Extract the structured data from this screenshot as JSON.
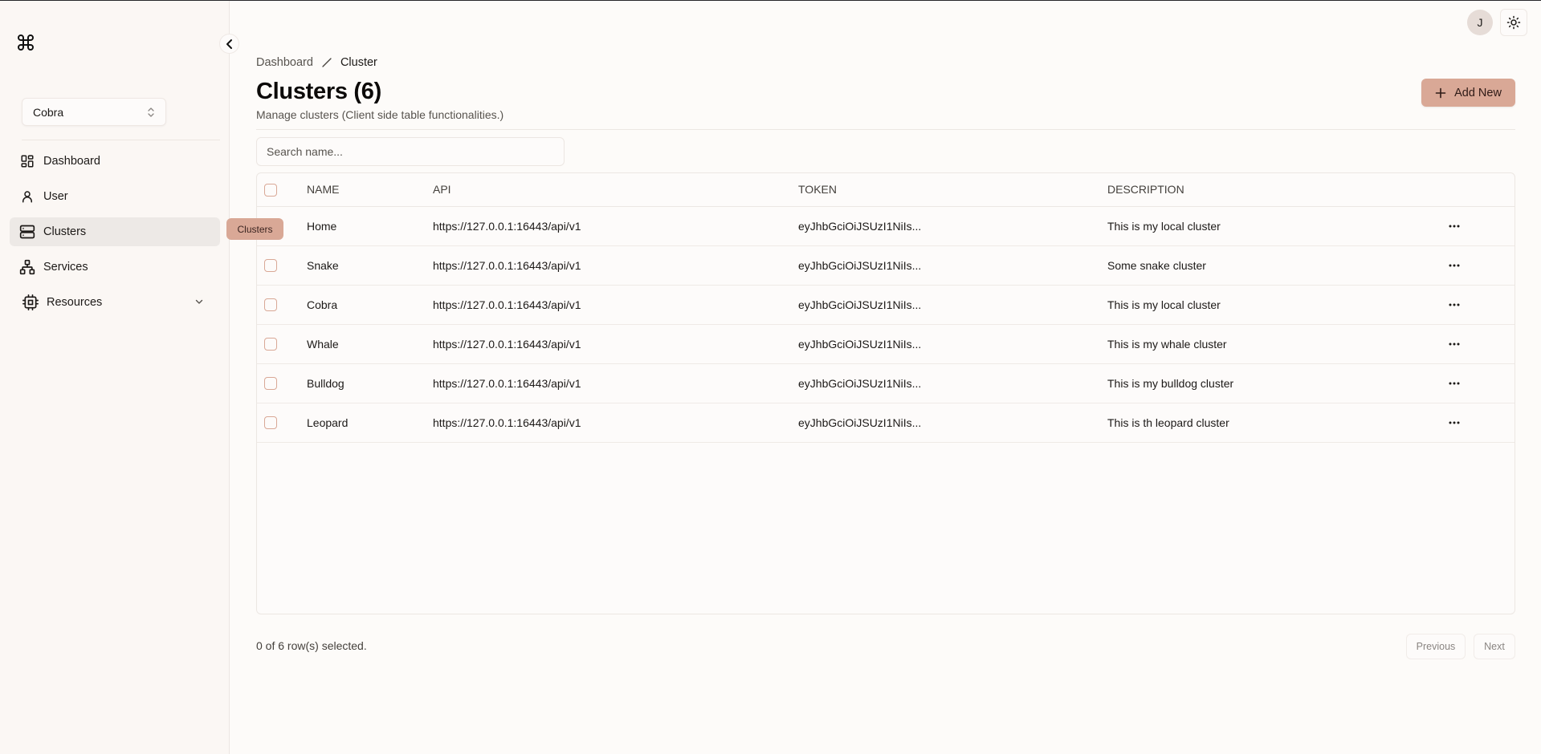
{
  "sidebar": {
    "team_select": {
      "value": "Cobra"
    },
    "items": [
      {
        "label": "Dashboard",
        "icon": "layout-dashboard-icon"
      },
      {
        "label": "User",
        "icon": "user-icon"
      },
      {
        "label": "Clusters",
        "icon": "server-icon",
        "active": true
      },
      {
        "label": "Services",
        "icon": "network-icon"
      },
      {
        "label": "Resources",
        "icon": "cpu-icon",
        "expandable": true
      }
    ],
    "tooltip": "Clusters"
  },
  "topbar": {
    "avatar_initial": "J",
    "theme_toggle_icon": "sun-icon"
  },
  "breadcrumb": {
    "items": [
      "Dashboard",
      "Cluster"
    ]
  },
  "header": {
    "title": "Clusters (6)",
    "subtitle": "Manage clusters (Client side table functionalities.)",
    "add_button_label": "Add New"
  },
  "search": {
    "placeholder": "Search name...",
    "value": ""
  },
  "table": {
    "columns": [
      "NAME",
      "API",
      "TOKEN",
      "DESCRIPTION"
    ],
    "rows": [
      {
        "name": "Home",
        "api": "https://127.0.0.1:16443/api/v1",
        "token": "eyJhbGciOiJSUzI1NiIs...",
        "description": "This is my local cluster"
      },
      {
        "name": "Snake",
        "api": "https://127.0.0.1:16443/api/v1",
        "token": "eyJhbGciOiJSUzI1NiIs...",
        "description": "Some snake cluster"
      },
      {
        "name": "Cobra",
        "api": "https://127.0.0.1:16443/api/v1",
        "token": "eyJhbGciOiJSUzI1NiIs...",
        "description": "This is my local cluster"
      },
      {
        "name": "Whale",
        "api": "https://127.0.0.1:16443/api/v1",
        "token": "eyJhbGciOiJSUzI1NiIs...",
        "description": "This is my whale cluster"
      },
      {
        "name": "Bulldog",
        "api": "https://127.0.0.1:16443/api/v1",
        "token": "eyJhbGciOiJSUzI1NiIs...",
        "description": "This is my bulldog cluster"
      },
      {
        "name": "Leopard",
        "api": "https://127.0.0.1:16443/api/v1",
        "token": "eyJhbGciOiJSUzI1NiIs...",
        "description": "This is th leopard cluster"
      }
    ]
  },
  "footer": {
    "selection_text": "0 of 6 row(s) selected.",
    "previous_label": "Previous",
    "next_label": "Next"
  },
  "colors": {
    "accent": "#d9a896",
    "background": "#fdfbf9",
    "sidebar_background": "#fbf7f4",
    "active_nav": "#ede9e6"
  }
}
